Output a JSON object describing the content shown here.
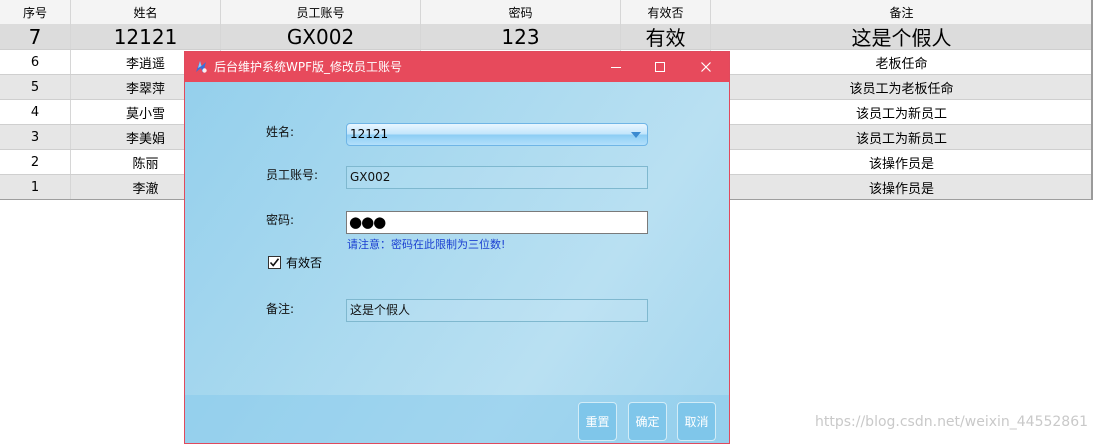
{
  "grid": {
    "headers": [
      "序号",
      "姓名",
      "员工账号",
      "密码",
      "有效否",
      "备注"
    ],
    "selected_row": {
      "seq": "7",
      "name": "12121",
      "account": "GX002",
      "password": "123",
      "valid": "有效",
      "remark": "这是个假人"
    },
    "rows": [
      {
        "seq": "6",
        "name": "李逍遥",
        "remark": "老板任命"
      },
      {
        "seq": "5",
        "name": "李翠萍",
        "remark": "该员工为老板任命"
      },
      {
        "seq": "4",
        "name": "莫小雪",
        "remark": "该员工为新员工"
      },
      {
        "seq": "3",
        "name": "李美娟",
        "remark": "该员工为新员工"
      },
      {
        "seq": "2",
        "name": "陈丽",
        "remark": "该操作员是"
      },
      {
        "seq": "1",
        "name": "李澈",
        "remark": "该操作员是"
      }
    ]
  },
  "dialog": {
    "title": "后台维护系统WPF版_修改员工账号",
    "icons": {
      "app": "app-icon",
      "minimize": "minimize-icon",
      "maximize": "maximize-icon",
      "close": "close-icon"
    },
    "form": {
      "name_label": "姓名:",
      "name_value": "12121",
      "account_label": "员工账号:",
      "account_value": "GX002",
      "password_label": "密码:",
      "password_mask": "●●●",
      "password_hint": "请注意：密码在此限制为三位数!",
      "valid_label": "有效否",
      "valid_checked": true,
      "remark_label": "备注:",
      "remark_value": "这是个假人"
    },
    "buttons": {
      "reset": "重置",
      "ok": "确定",
      "cancel": "取消"
    }
  },
  "watermark": "https://blog.csdn.net/weixin_44552861",
  "colors": {
    "titlebar": "#e74a5c",
    "hint": "#1a3fd1",
    "dialog_bg": "#a9d9ef"
  }
}
